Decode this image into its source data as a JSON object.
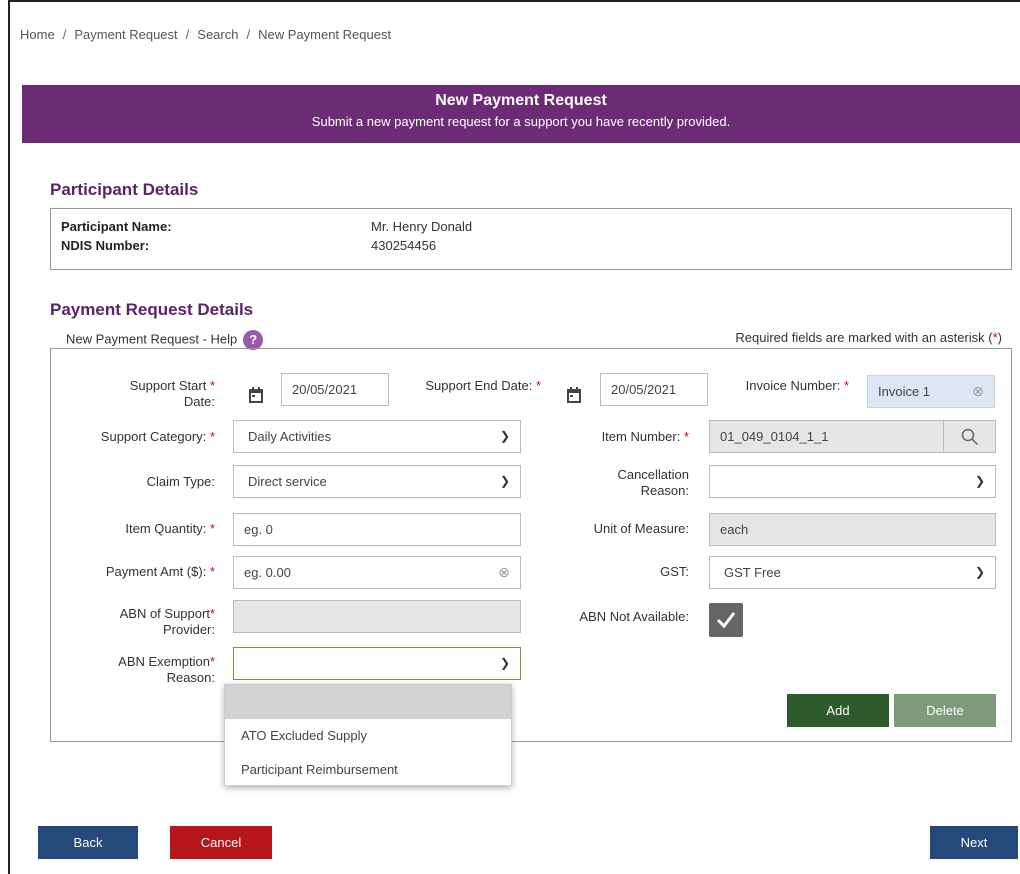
{
  "breadcrumb": [
    "Home",
    "Payment Request",
    "Search",
    "New Payment Request"
  ],
  "banner": {
    "title": "New Payment Request",
    "subtitle": "Submit a new payment request for a support you have recently provided."
  },
  "participant": {
    "section_title": "Participant Details",
    "name_label": "Participant Name:",
    "name_value": "Mr. Henry Donald",
    "ndis_label": "NDIS Number:",
    "ndis_value": "430254456"
  },
  "payment": {
    "section_title": "Payment Request Details",
    "help_label": "New Payment Request - Help",
    "help_icon": "?",
    "required_note": "Required fields are marked with an asterisk (",
    "required_star": "*",
    "required_close": ")"
  },
  "form": {
    "support_start_label": "Support Start",
    "support_start_label2": "Date:",
    "support_start_value": "20/05/2021",
    "support_end_label": "Support End Date:",
    "support_end_value": "20/05/2021",
    "invoice_label": "Invoice Number:",
    "invoice_value": "Invoice 1",
    "support_category_label": "Support Category:",
    "support_category_value": "Daily Activities",
    "item_number_label": "Item Number:",
    "item_number_value": "01_049_0104_1_1",
    "claim_type_label": "Claim Type:",
    "claim_type_value": "Direct service",
    "cancellation_label": "Cancellation",
    "cancellation_label2": "Reason:",
    "cancellation_value": "",
    "item_quantity_label": "Item Quantity:",
    "item_quantity_placeholder": "eg. 0",
    "unit_label": "Unit of Measure:",
    "unit_value": "each",
    "payment_amt_label": "Payment Amt ($):",
    "payment_amt_placeholder": "eg. 0.00",
    "gst_label": "GST:",
    "gst_value": "GST Free",
    "abn_provider_label": "ABN of Support",
    "abn_provider_label2": "Provider:",
    "abn_not_available_label": "ABN Not Available:",
    "abn_not_available_checked": true,
    "abn_exemption_label": "ABN Exemption",
    "abn_exemption_label2": "Reason:",
    "abn_exemption_value": "",
    "abn_exemption_options": [
      "",
      "ATO Excluded Supply",
      "Participant Reimbursement"
    ],
    "star": "*"
  },
  "buttons": {
    "add": "Add",
    "delete": "Delete",
    "back": "Back",
    "cancel": "Cancel",
    "next": "Next"
  },
  "colors": {
    "banner": "#6b2c75",
    "section_title": "#5b2466",
    "add": "#2e5a2c",
    "delete": "#7f9a7b",
    "back": "#24497a",
    "cancel": "#b8151b",
    "next": "#24497a"
  },
  "icons": {
    "calendar": "calendar-icon",
    "clear": "clear-circle-icon",
    "search": "search-icon",
    "chevron": "chevron-down-icon",
    "check": "checkmark-icon"
  }
}
